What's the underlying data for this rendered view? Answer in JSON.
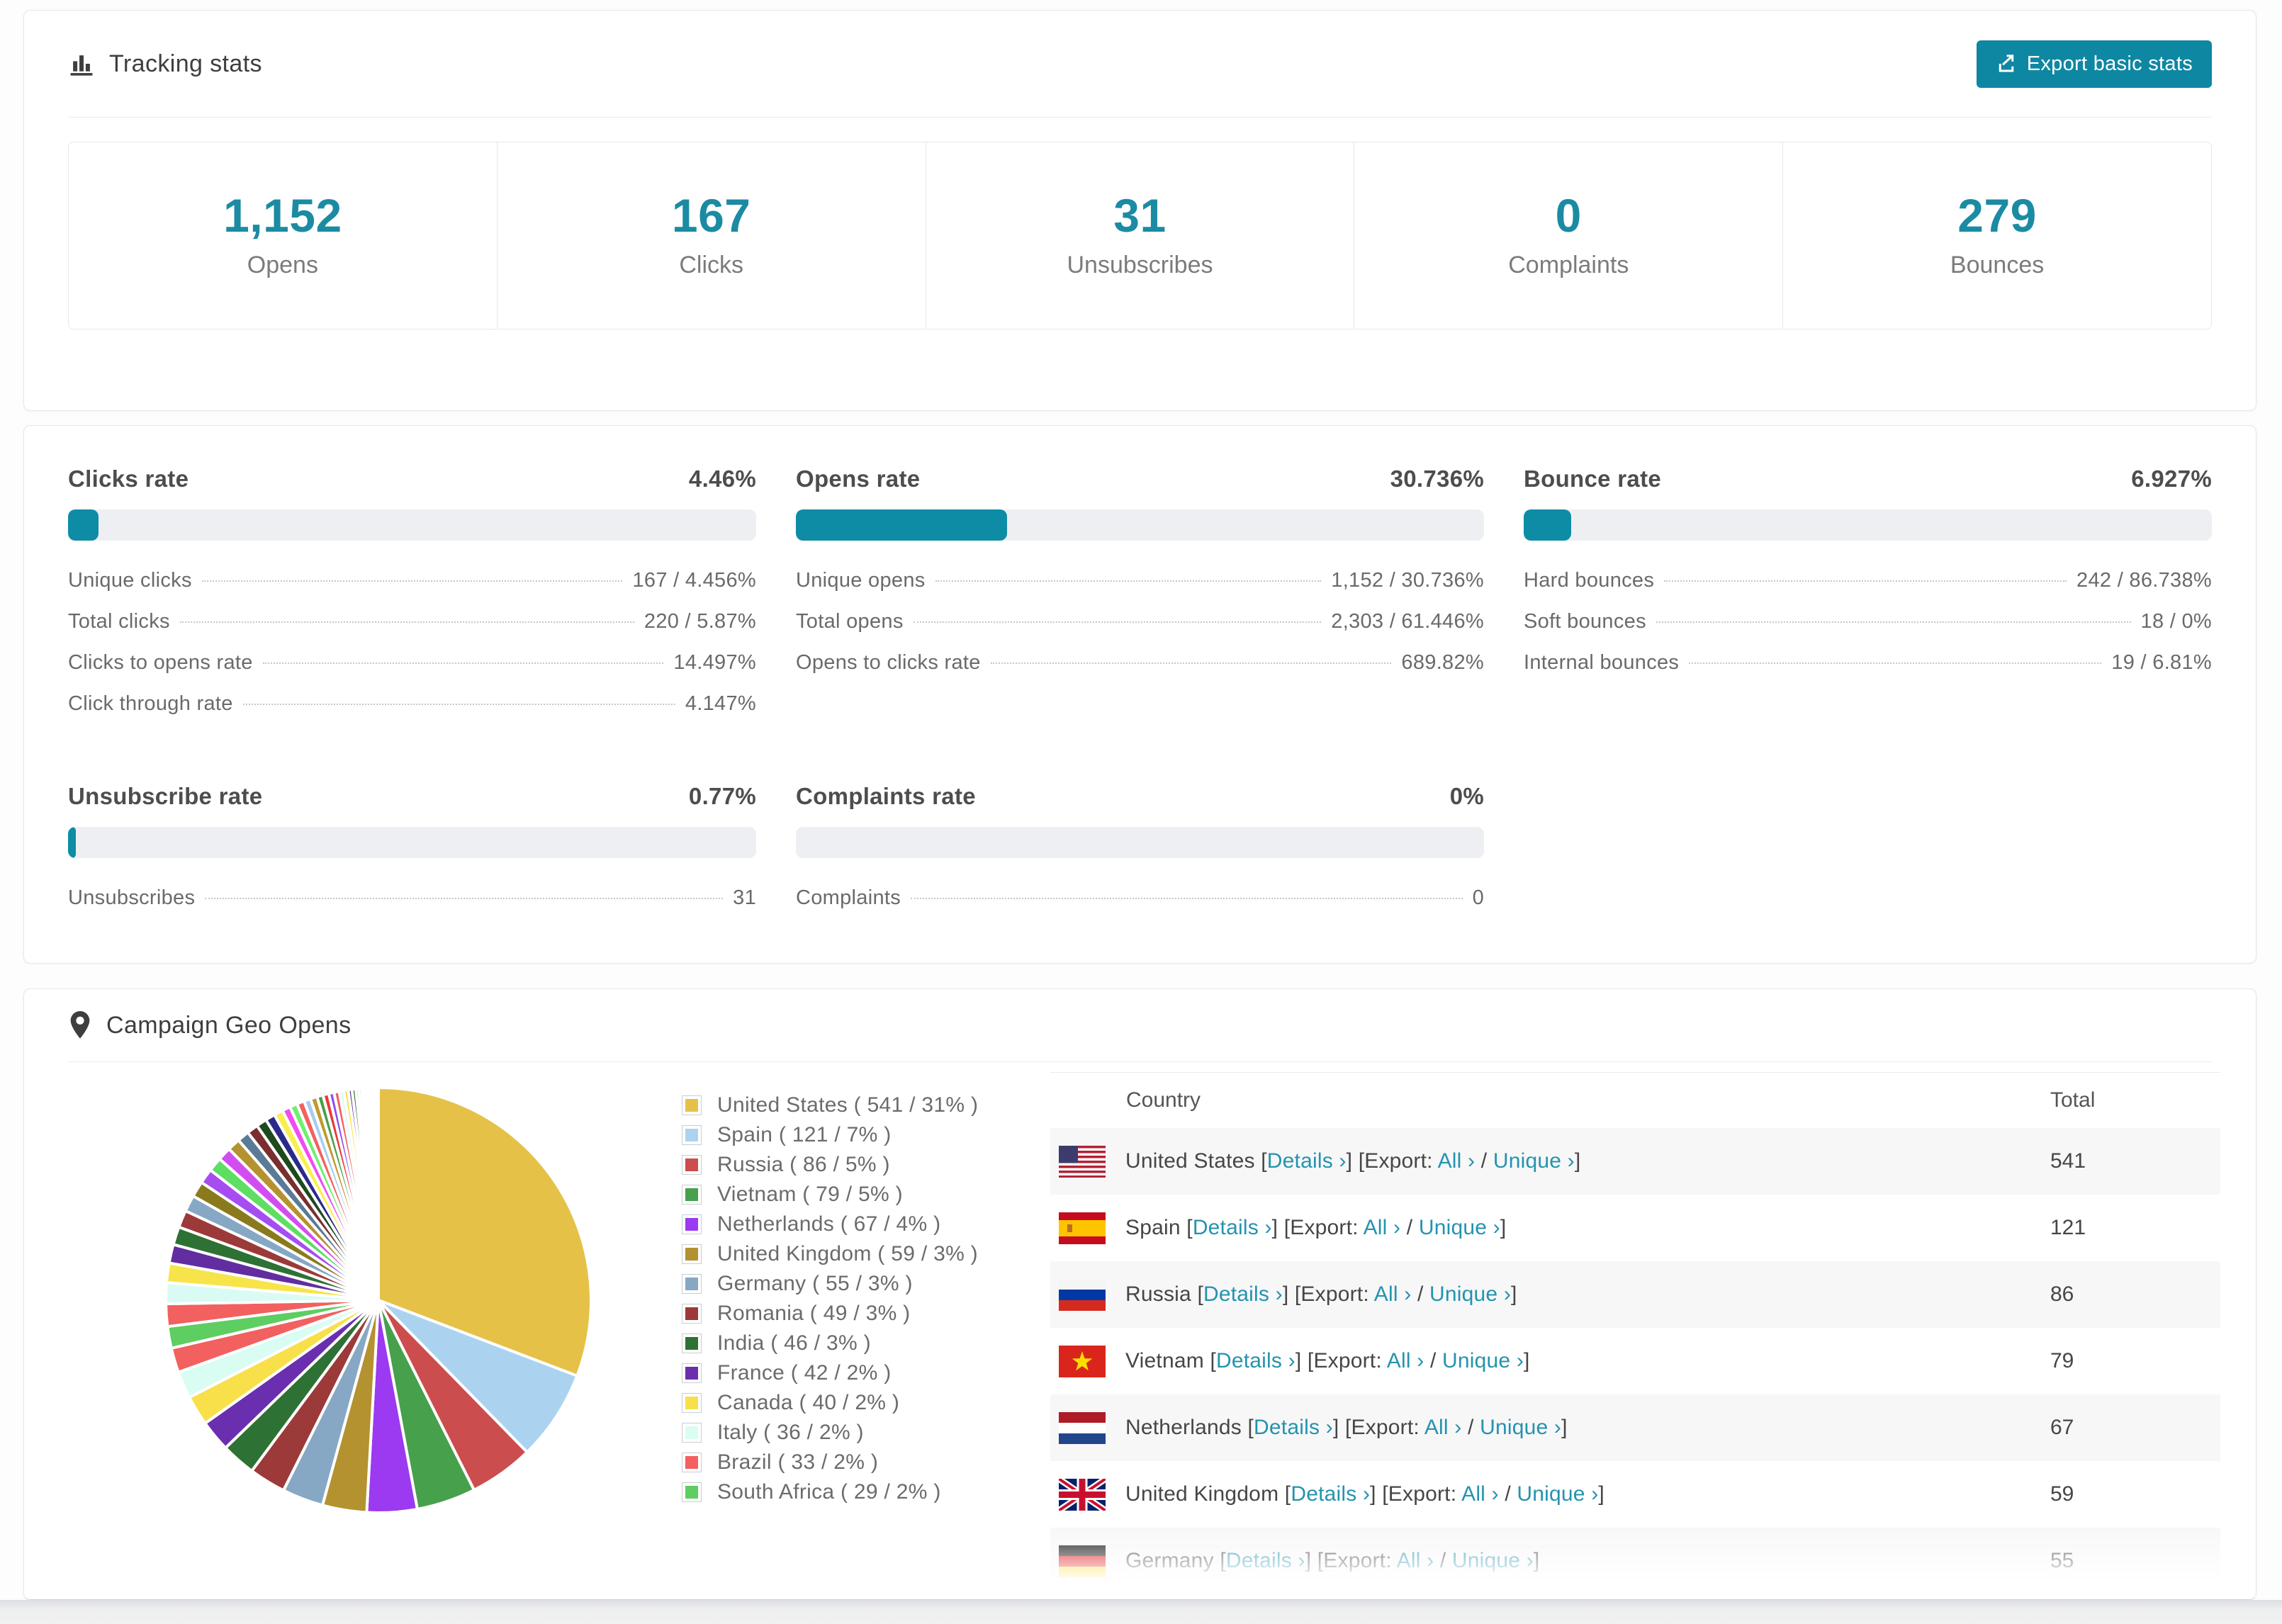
{
  "teal": "#0e87a3",
  "tracking": {
    "title": "Tracking stats",
    "export_button": "Export basic stats",
    "stats": [
      {
        "value": "1,152",
        "label": "Opens"
      },
      {
        "value": "167",
        "label": "Clicks"
      },
      {
        "value": "31",
        "label": "Unsubscribes"
      },
      {
        "value": "0",
        "label": "Complaints"
      },
      {
        "value": "279",
        "label": "Bounces"
      }
    ]
  },
  "rates": {
    "sections": [
      {
        "title": "Clicks rate",
        "percent": "4.46%",
        "bar_percent": 4.46,
        "rows": [
          {
            "label": "Unique clicks",
            "value": "167 / 4.456%"
          },
          {
            "label": "Total clicks",
            "value": "220 / 5.87%"
          },
          {
            "label": "Clicks to opens rate",
            "value": "14.497%"
          },
          {
            "label": "Click through rate",
            "value": "4.147%"
          }
        ]
      },
      {
        "title": "Opens rate",
        "percent": "30.736%",
        "bar_percent": 30.736,
        "rows": [
          {
            "label": "Unique opens",
            "value": "1,152 / 30.736%"
          },
          {
            "label": "Total opens",
            "value": "2,303 / 61.446%"
          },
          {
            "label": "Opens to clicks rate",
            "value": "689.82%"
          }
        ]
      },
      {
        "title": "Bounce rate",
        "percent": "6.927%",
        "bar_percent": 6.927,
        "rows": [
          {
            "label": "Hard bounces",
            "value": "242 / 86.738%"
          },
          {
            "label": "Soft bounces",
            "value": "18 / 0%"
          },
          {
            "label": "Internal bounces",
            "value": "19 / 6.81%"
          }
        ]
      },
      {
        "title": "Unsubscribe rate",
        "percent": "0.77%",
        "bar_percent": 0.77,
        "rows": [
          {
            "label": "Unsubscribes",
            "value": "31"
          }
        ]
      },
      {
        "title": "Complaints rate",
        "percent": "0%",
        "bar_percent": 0,
        "rows": [
          {
            "label": "Complaints",
            "value": "0"
          }
        ]
      }
    ]
  },
  "geo": {
    "title": "Campaign Geo Opens",
    "table": {
      "columns": [
        "Country",
        "Total"
      ],
      "details_label": "Details ›",
      "export_prefix": "[Export: ",
      "all_label": "All ›",
      "separator": " / ",
      "unique_label": "Unique ›",
      "rows": [
        {
          "country": "United States",
          "flag": "us",
          "total": "541"
        },
        {
          "country": "Spain",
          "flag": "es",
          "total": "121"
        },
        {
          "country": "Russia",
          "flag": "ru",
          "total": "86"
        },
        {
          "country": "Vietnam",
          "flag": "vn",
          "total": "79"
        },
        {
          "country": "Netherlands",
          "flag": "nl",
          "total": "67"
        },
        {
          "country": "United Kingdom",
          "flag": "gb",
          "total": "59"
        },
        {
          "country": "Germany",
          "flag": "de",
          "total": "55"
        }
      ]
    },
    "chart_data": {
      "type": "pie",
      "title": "Campaign Geo Opens",
      "legend_position": "right",
      "labels": [
        "United States",
        "Spain",
        "Russia",
        "Vietnam",
        "Netherlands",
        "United Kingdom",
        "Germany",
        "Romania",
        "India",
        "France",
        "Canada",
        "Italy",
        "Brazil",
        "South Africa"
      ],
      "values": [
        541,
        121,
        86,
        79,
        67,
        59,
        55,
        49,
        46,
        42,
        40,
        36,
        33,
        29
      ],
      "percents": [
        31,
        7,
        5,
        5,
        4,
        3,
        3,
        3,
        3,
        2,
        2,
        2,
        2,
        2
      ],
      "legend_labels": [
        "United States ( 541 / 31% )",
        "Spain ( 121 / 7% )",
        "Russia ( 86 / 5% )",
        "Vietnam ( 79 / 5% )",
        "Netherlands ( 67 / 4% )",
        "United Kingdom ( 59 / 3% )",
        "Germany ( 55 / 3% )",
        "Romania ( 49 / 3% )",
        "India ( 46 / 3% )",
        "France ( 42 / 2% )",
        "Canada ( 40 / 2% )",
        "Italy ( 36 / 2% )",
        "Brazil ( 33 / 2% )",
        "South Africa ( 29 / 2% )"
      ],
      "colors": [
        "#e5c148",
        "#abd3f0",
        "#cc4d4d",
        "#47a04b",
        "#9b3af0",
        "#b3922f",
        "#87a8c4",
        "#9c3a3a",
        "#2e7134",
        "#6a2fae",
        "#f8e04b",
        "#d9fcf3",
        "#f2605f",
        "#5ecd62"
      ],
      "unlabeled_other_slices_estimated": [
        30,
        28,
        26,
        25,
        24,
        23,
        22,
        21,
        20,
        19,
        18,
        17,
        16,
        15,
        14,
        13,
        12,
        11,
        10,
        10,
        9,
        9,
        8,
        8,
        7,
        7,
        6,
        6,
        5,
        5,
        4,
        4,
        3,
        3,
        3,
        2,
        2,
        2,
        2,
        1,
        1,
        1,
        1,
        1
      ],
      "others_palette": [
        "#f2605f",
        "#d9fbf4",
        "#f7e44b",
        "#622da0",
        "#2e7134",
        "#9c3a3a",
        "#87a8c4",
        "#8a7a1e",
        "#a64df2",
        "#5ede62",
        "#d24df0",
        "#b3922f",
        "#5a7a96",
        "#7a2e2e",
        "#1e4a1e",
        "#2a2a8a",
        "#f7f04b",
        "#f04df0",
        "#6ef06e",
        "#f26060",
        "#a8ccf0",
        "#c09a2e",
        "#47a04b",
        "#e83a3a",
        "#8a4df0"
      ]
    }
  }
}
